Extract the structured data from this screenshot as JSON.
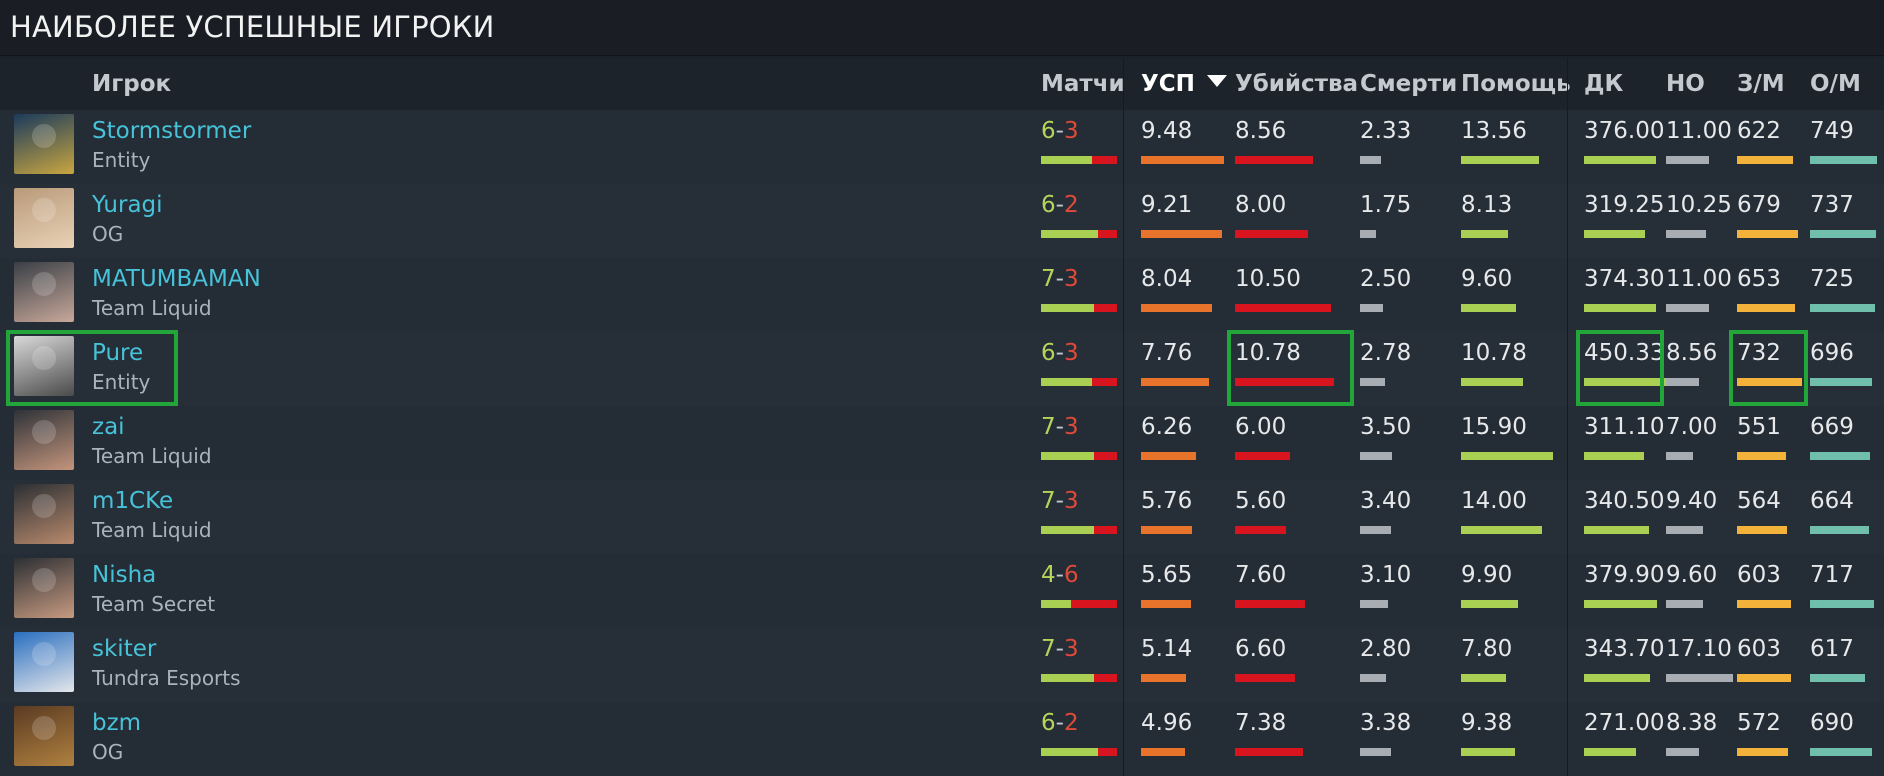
{
  "section_title": "НАИБОЛЕЕ УСПЕШНЫЕ ИГРОКИ",
  "columns": {
    "player": "Игрок",
    "matches": "Матчи",
    "kda": "УСП",
    "kills": "Убийства",
    "deaths": "Смерти",
    "assists": "Помощь",
    "last_hits": "ДК",
    "denies": "НО",
    "gpm": "З/М",
    "xpm": "О/М"
  },
  "sort": {
    "column": "kda",
    "direction": "desc",
    "icon": "sort-desc-icon"
  },
  "colors": {
    "kda_bar": "#e8732a",
    "kills_bar": "#d8141f",
    "deaths_bar": "#a7adb3",
    "assists_bar": "#a9cf53",
    "last_hits_bar": "#a9cf53",
    "denies_bar": "#a7adb3",
    "gpm_bar": "#f3b33a",
    "xpm_bar": "#6fbfac",
    "win_text": "#b5d55a",
    "loss_text": "#e04a38",
    "player_name": "#46c2d9",
    "highlight": "#22a63a"
  },
  "players": [
    {
      "name": "Stormstormer",
      "team": "Entity",
      "wins": "6",
      "losses": "3",
      "kda": "9.48",
      "kills": "8.56",
      "deaths": "2.33",
      "assists": "13.56",
      "last_hits": "376.00",
      "denies": "11.00",
      "gpm": "622",
      "xpm": "749",
      "avatar_colors": [
        "#1b3a5c",
        "#c9a640"
      ]
    },
    {
      "name": "Yuragi",
      "team": "OG",
      "wins": "6",
      "losses": "2",
      "kda": "9.21",
      "kills": "8.00",
      "deaths": "1.75",
      "assists": "8.13",
      "last_hits": "319.25",
      "denies": "10.25",
      "gpm": "679",
      "xpm": "737",
      "avatar_colors": [
        "#b99a7a",
        "#e9d2b6"
      ]
    },
    {
      "name": "MATUMBAMAN",
      "team": "Team Liquid",
      "wins": "7",
      "losses": "3",
      "kda": "8.04",
      "kills": "10.50",
      "deaths": "2.50",
      "assists": "9.60",
      "last_hits": "374.30",
      "denies": "11.00",
      "gpm": "653",
      "xpm": "725",
      "avatar_colors": [
        "#3a3f46",
        "#c8a89a"
      ]
    },
    {
      "name": "Pure",
      "team": "Entity",
      "wins": "6",
      "losses": "3",
      "kda": "7.76",
      "kills": "10.78",
      "deaths": "2.78",
      "assists": "10.78",
      "last_hits": "450.33",
      "denies": "8.56",
      "gpm": "732",
      "xpm": "696",
      "avatar_colors": [
        "#d9d9d9",
        "#4a4a4a"
      ]
    },
    {
      "name": "zai",
      "team": "Team Liquid",
      "wins": "7",
      "losses": "3",
      "kda": "6.26",
      "kills": "6.00",
      "deaths": "3.50",
      "assists": "15.90",
      "last_hits": "311.10",
      "denies": "7.00",
      "gpm": "551",
      "xpm": "669",
      "avatar_colors": [
        "#2e3238",
        "#c4957c"
      ]
    },
    {
      "name": "m1CKe",
      "team": "Team Liquid",
      "wins": "7",
      "losses": "3",
      "kda": "5.76",
      "kills": "5.60",
      "deaths": "3.40",
      "assists": "14.00",
      "last_hits": "340.50",
      "denies": "9.40",
      "gpm": "564",
      "xpm": "664",
      "avatar_colors": [
        "#2b2f34",
        "#b98a6c"
      ]
    },
    {
      "name": "Nisha",
      "team": "Team Secret",
      "wins": "4",
      "losses": "6",
      "kda": "5.65",
      "kills": "7.60",
      "deaths": "3.10",
      "assists": "9.90",
      "last_hits": "379.90",
      "denies": "9.60",
      "gpm": "603",
      "xpm": "717",
      "avatar_colors": [
        "#2c2f33",
        "#c79a80"
      ]
    },
    {
      "name": "skiter",
      "team": "Tundra Esports",
      "wins": "7",
      "losses": "3",
      "kda": "5.14",
      "kills": "6.60",
      "deaths": "2.80",
      "assists": "7.80",
      "last_hits": "343.70",
      "denies": "17.10",
      "gpm": "603",
      "xpm": "617",
      "avatar_colors": [
        "#2a6fc0",
        "#e4e6ea"
      ]
    },
    {
      "name": "bzm",
      "team": "OG",
      "wins": "6",
      "losses": "2",
      "kda": "4.96",
      "kills": "7.38",
      "deaths": "3.38",
      "assists": "9.38",
      "last_hits": "271.00",
      "denies": "8.38",
      "gpm": "572",
      "xpm": "690",
      "avatar_colors": [
        "#5a3a22",
        "#b0813f"
      ]
    }
  ],
  "highlighted": [
    {
      "row": 3,
      "column": "player"
    },
    {
      "row": 3,
      "column": "kills"
    },
    {
      "row": 3,
      "column": "last_hits"
    },
    {
      "row": 3,
      "column": "gpm"
    }
  ]
}
